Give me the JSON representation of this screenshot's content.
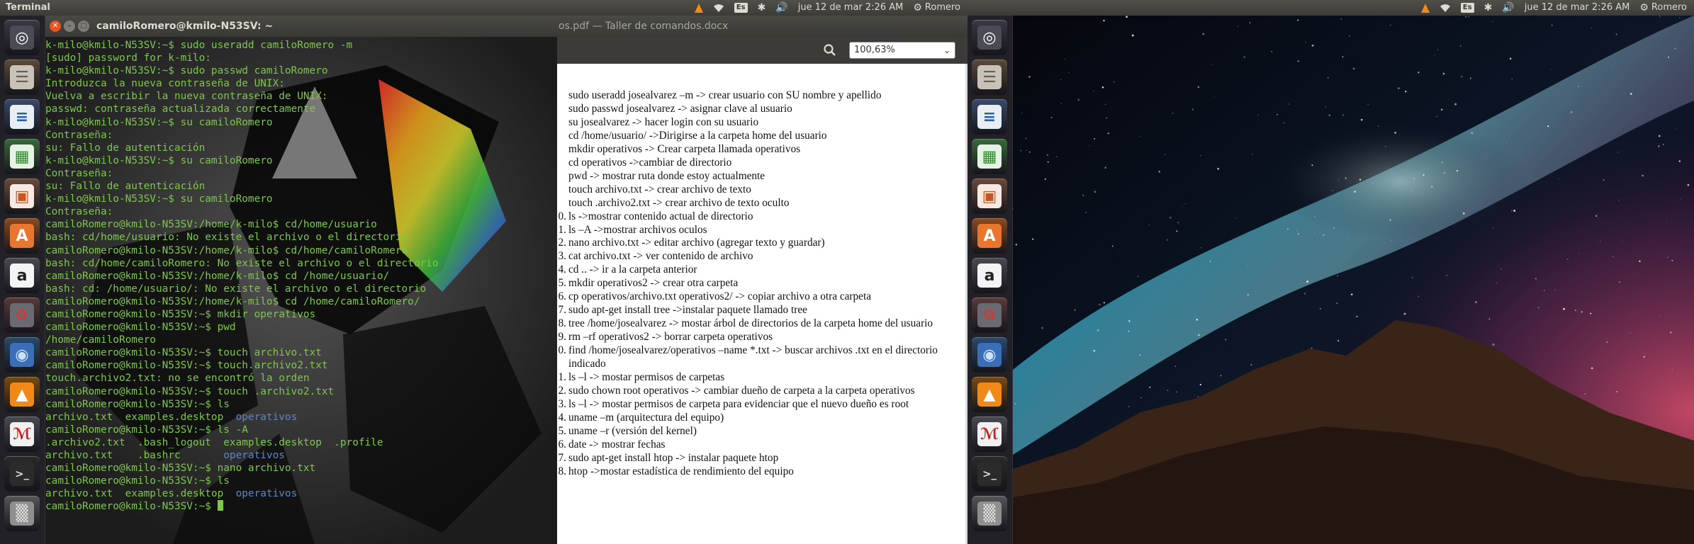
{
  "top_panel_left": {
    "app_title": "Terminal",
    "keyboard": "Es",
    "datetime": "jue 12 de mar  2:26 AM",
    "user": "Romero"
  },
  "top_panel_right": {
    "keyboard": "Es",
    "datetime": "jue 12 de mar  2:26 AM",
    "user": "Romero"
  },
  "launcher": {
    "items": [
      {
        "name": "dash-home",
        "icon": "ubuntu-logo-icon"
      },
      {
        "name": "files",
        "icon": "file-cabinet-icon"
      },
      {
        "name": "writer",
        "icon": "libreoffice-writer-icon"
      },
      {
        "name": "calc",
        "icon": "libreoffice-calc-icon"
      },
      {
        "name": "impress",
        "icon": "libreoffice-impress-icon"
      },
      {
        "name": "software-center",
        "icon": "shopping-bag-icon"
      },
      {
        "name": "amazon",
        "icon": "amazon-icon"
      },
      {
        "name": "system-settings",
        "icon": "gear-wrench-icon"
      },
      {
        "name": "chromium",
        "icon": "chromium-icon"
      },
      {
        "name": "vlc",
        "icon": "vlc-cone-icon"
      },
      {
        "name": "document-viewer",
        "icon": "document-viewer-icon"
      },
      {
        "name": "terminal",
        "icon": "terminal-icon"
      },
      {
        "name": "trash",
        "icon": "trash-icon"
      }
    ]
  },
  "terminal": {
    "title": "camiloRomero@kmilo-N53SV: ~",
    "lines": [
      "k-milo@kmilo-N53SV:~$ sudo useradd camiloRomero -m",
      "[sudo] password for k-milo:",
      "k-milo@kmilo-N53SV:~$ sudo passwd camiloRomero",
      "Introduzca la nueva contraseña de UNIX:",
      "Vuelva a escribir la nueva contraseña de UNIX:",
      "passwd: contraseña actualizada correctamente",
      "k-milo@kmilo-N53SV:~$ su camiloRomero",
      "Contraseña:",
      "su: Fallo de autenticación",
      "k-milo@kmilo-N53SV:~$ su camiloRomero",
      "Contraseña:",
      "su: Fallo de autenticación",
      "k-milo@kmilo-N53SV:~$ su camiloRomero",
      "Contraseña:",
      "camiloRomero@kmilo-N53SV:/home/k-milo$ cd/home/usuario",
      "bash: cd/home/usuario: No existe el archivo o el directorio",
      "camiloRomero@kmilo-N53SV:/home/k-milo$ cd/home/camiloRomero",
      "bash: cd/home/camiloRomero: No existe el archivo o el directorio",
      "camiloRomero@kmilo-N53SV:/home/k-milo$ cd /home/usuario/",
      "bash: cd: /home/usuario/: No existe el archivo o el directorio",
      "camiloRomero@kmilo-N53SV:/home/k-milo$ cd /home/camiloRomero/",
      "camiloRomero@kmilo-N53SV:~$ mkdir operativos",
      "camiloRomero@kmilo-N53SV:~$ pwd",
      "/home/camiloRomero",
      "camiloRomero@kmilo-N53SV:~$ touch archivo.txt",
      "camiloRomero@kmilo-N53SV:~$ touch.archivo2.txt",
      "touch.archivo2.txt: no se encontró la orden",
      "camiloRomero@kmilo-N53SV:~$ touch .archivo2.txt",
      "camiloRomero@kmilo-N53SV:~$ ls",
      "archivo.txt  examples.desktop  ",
      "camiloRomero@kmilo-N53SV:~$ ls -A",
      ".archivo2.txt  .bash_logout  examples.desktop  .profile",
      "archivo.txt    .bashrc       ",
      "camiloRomero@kmilo-N53SV:~$ nano archivo.txt",
      "camiloRomero@kmilo-N53SV:~$ ls",
      "archivo.txt  examples.desktop  ",
      "camiloRomero@kmilo-N53SV:~$ "
    ],
    "dir_name": "operativos"
  },
  "document": {
    "title": "os.pdf — Taller de comandos.docx",
    "zoom": "100,63%",
    "items": [
      {
        "num": "",
        "text": "sudo  useradd josealvarez –m -> crear usuario con SU nombre y apellido"
      },
      {
        "num": "",
        "text": "sudo passwd josealvarez -> asignar clave al usuario"
      },
      {
        "num": "",
        "text": "su josealvarez -> hacer login con su usuario"
      },
      {
        "num": "",
        "text": "cd /home/usuario/ ->Dirigirse a la carpeta home del usuario"
      },
      {
        "num": "",
        "text": "mkdir operativos -> Crear carpeta llamada operativos"
      },
      {
        "num": "",
        "text": "cd operativos ->cambiar de directorio"
      },
      {
        "num": "",
        "text": "pwd -> mostrar ruta donde estoy actualmente"
      },
      {
        "num": "",
        "text": "touch archivo.txt -> crear archivo de texto"
      },
      {
        "num": "",
        "text": "touch .archivo2.txt -> crear archivo de texto oculto"
      },
      {
        "num": "0",
        "text": "ls ->mostrar contenido actual de directorio"
      },
      {
        "num": "1",
        "text": "ls –A ->mostrar archivos oculos"
      },
      {
        "num": "2",
        "text": "nano archivo.txt -> editar archivo (agregar texto y guardar)"
      },
      {
        "num": "3",
        "text": "cat archivo.txt -> ver contenido de archivo"
      },
      {
        "num": "4",
        "text": "cd .. -> ir a la carpeta anterior"
      },
      {
        "num": "5",
        "text": "mkdir operativos2 -> crear otra carpeta"
      },
      {
        "num": "6",
        "text": "cp operativos/archivo.txt operativos2/ -> copiar archivo a otra carpeta"
      },
      {
        "num": "7",
        "text": "sudo apt-get install tree ->instalar paquete llamado tree"
      },
      {
        "num": "8",
        "text": "tree /home/josealvarez -> mostar árbol de directorios de la carpeta home del usuario"
      },
      {
        "num": "9",
        "text": "rm –rf operativos2 -> borrar carpeta operativos"
      },
      {
        "num": "0",
        "text": "find /home/josealvarez/operativos –name *.txt -> buscar archivos .txt en el directorio indicado"
      },
      {
        "num": "1",
        "text": "ls –l -> mostar permisos de carpetas"
      },
      {
        "num": "2",
        "text": "sudo chown root operativos -> cambiar dueño de carpeta a la carpeta operativos"
      },
      {
        "num": "3",
        "text": "ls –l -> mostar permisos de carpeta para evidenciar que el nuevo dueño es root"
      },
      {
        "num": "4",
        "text": "uname –m (arquitectura del equipo)"
      },
      {
        "num": "5",
        "text": "uname –r (versión del kernel)"
      },
      {
        "num": "6",
        "text": "date -> mostrar fechas"
      },
      {
        "num": "7",
        "text": "sudo apt-get install htop -> instalar paquete htop"
      },
      {
        "num": "8",
        "text": "htop ->mostar estadística de rendimiento del equipo"
      }
    ]
  },
  "colors": {
    "terminal_text": "#7ec74a",
    "terminal_dir": "#5e86c4",
    "panel_bg": "#3c3b37",
    "close_button": "#e95420"
  }
}
